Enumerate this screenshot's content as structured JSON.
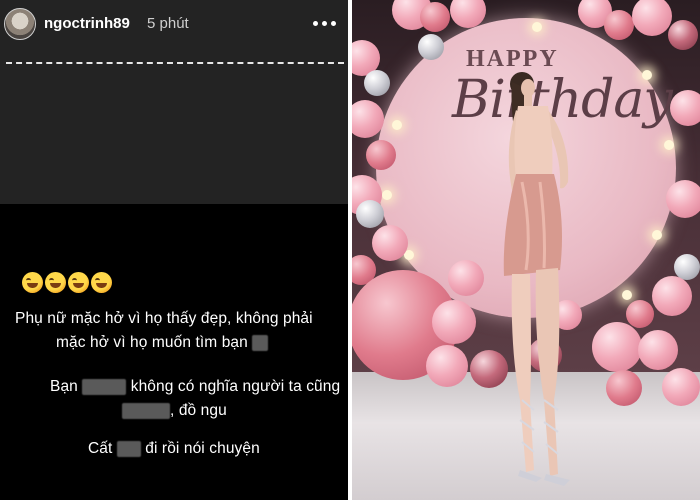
{
  "story": {
    "username": "ngoctrinh89",
    "time_ago": "5 phút",
    "more_icon": "more-horizontal-icon",
    "emoji_count": 4,
    "emoji_name": "rolling-on-the-floor-laughing-emoji",
    "lines": {
      "l1": "Phụ nữ mặc hở vì họ thấy đẹp, không phải",
      "l2": "mặc hở vì họ muốn tìm bạn",
      "l3a": "Bạn",
      "l3b": "không có nghĩa người ta cũng",
      "l4": ", đồ ngu",
      "l5a": "Cất",
      "l5b": "đi rồi nói chuyện"
    },
    "colors": {
      "header_bg": "#232323",
      "body_bg": "#000000",
      "text": "#ffffff"
    }
  },
  "photo": {
    "sign_happy": "HAPPY",
    "sign_birthday": "Birthday",
    "colors": {
      "backdrop": "#e9b9c4",
      "balloon_pink": "#f2a9b9",
      "balloon_silver": "#cfcfd6"
    }
  }
}
